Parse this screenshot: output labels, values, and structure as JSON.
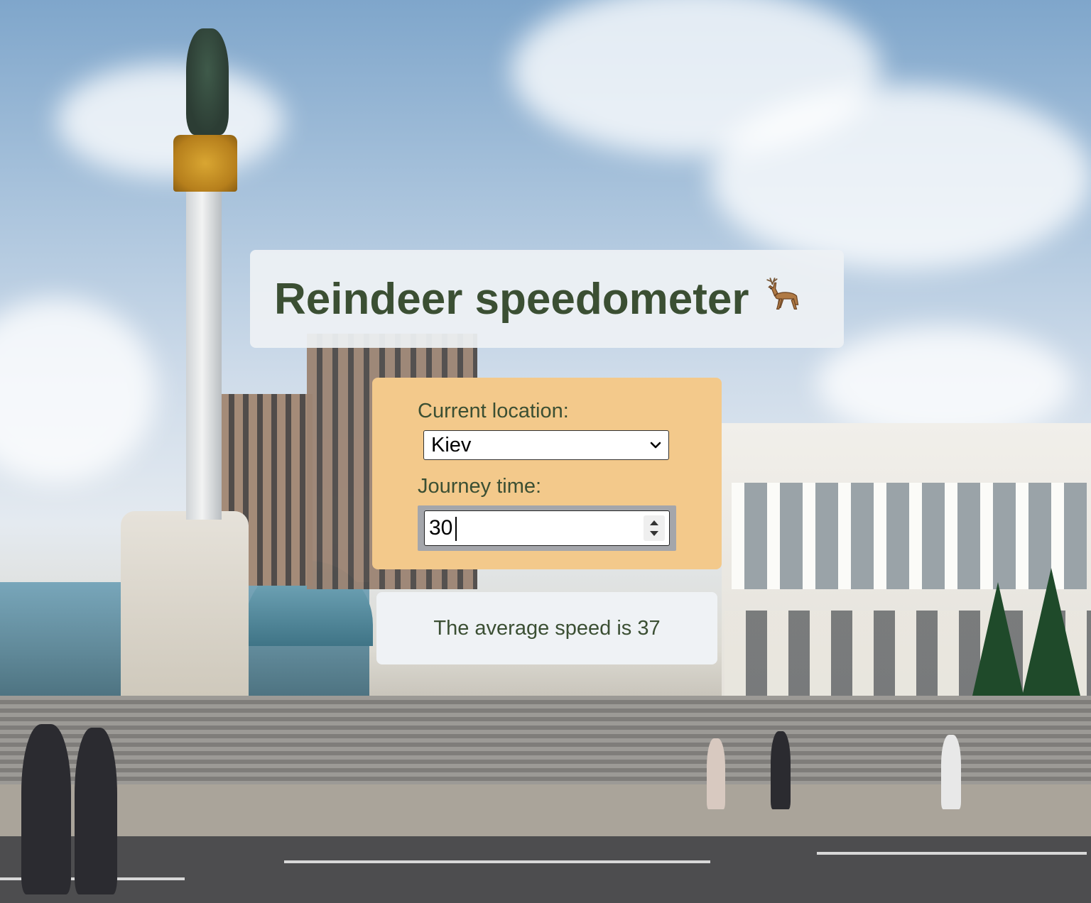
{
  "header": {
    "title": "Reindeer speedometer",
    "title_icon": "deer-icon"
  },
  "form": {
    "location_label": "Current location:",
    "location_value": "Kiev",
    "journey_label": "Journey time:",
    "journey_value": "30"
  },
  "result": {
    "prefix": "The average speed is",
    "value": "37"
  },
  "colors": {
    "title_text": "#3b4f33",
    "form_background": "#f3c98b",
    "card_background": "#eef1f4"
  },
  "background": {
    "scene": "city-square-photo"
  }
}
